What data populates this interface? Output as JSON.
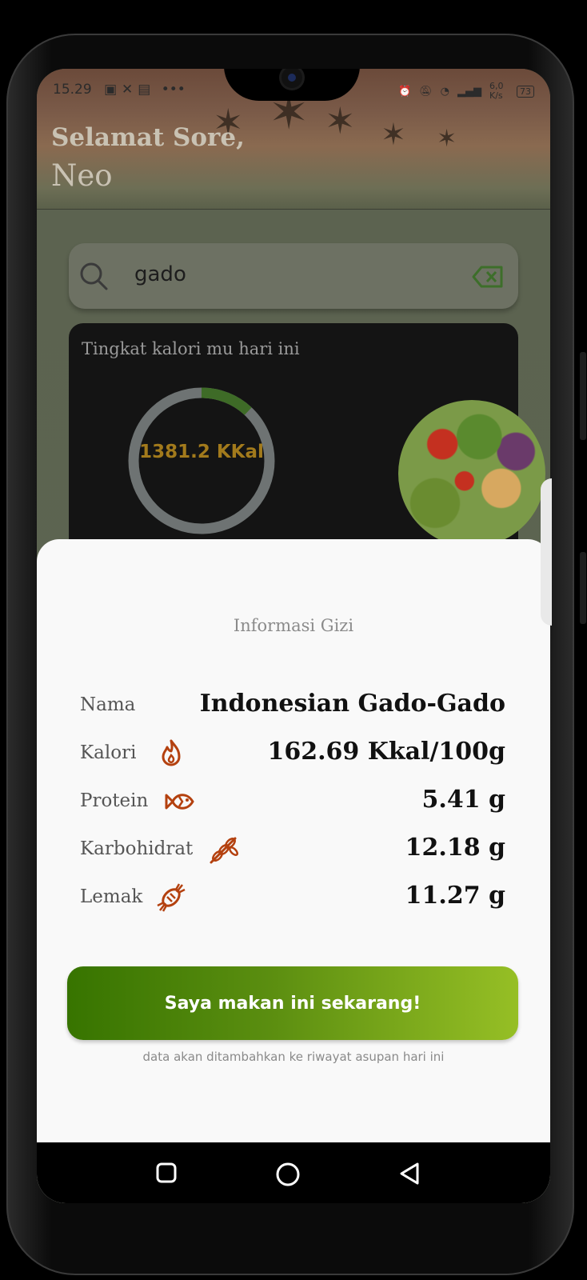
{
  "status_bar": {
    "time": "15.29",
    "apps": "•••",
    "speed": "6,0 K/s",
    "battery": "73"
  },
  "header": {
    "greeting": "Selamat Sore,",
    "name": "Neo"
  },
  "search": {
    "value": "gado"
  },
  "calorie_card": {
    "title": "Tingkat kalori mu hari ini",
    "value": "1381.2 KKal",
    "progress": 0.12
  },
  "sheet": {
    "title": "Informasi Gizi",
    "rows": [
      {
        "label": "Nama",
        "value": "Indonesian Gado-Gado",
        "icon": ""
      },
      {
        "label": "Kalori",
        "value": "162.69 Kkal/100g",
        "icon": "fire-icon"
      },
      {
        "label": "Protein",
        "value": "5.41 g",
        "icon": "fish-icon"
      },
      {
        "label": "Karbohidrat",
        "value": "12.18 g",
        "icon": "wheat-icon"
      },
      {
        "label": "Lemak",
        "value": "11.27 g",
        "icon": "candy-icon"
      }
    ],
    "cta_label": "Saya makan ini sekarang!",
    "cta_note": "data akan ditambahkan ke riwayat asupan hari ini"
  },
  "colors": {
    "accent_orange": "#b4410f",
    "cta_start": "#377400",
    "cta_end": "#96bf25"
  }
}
